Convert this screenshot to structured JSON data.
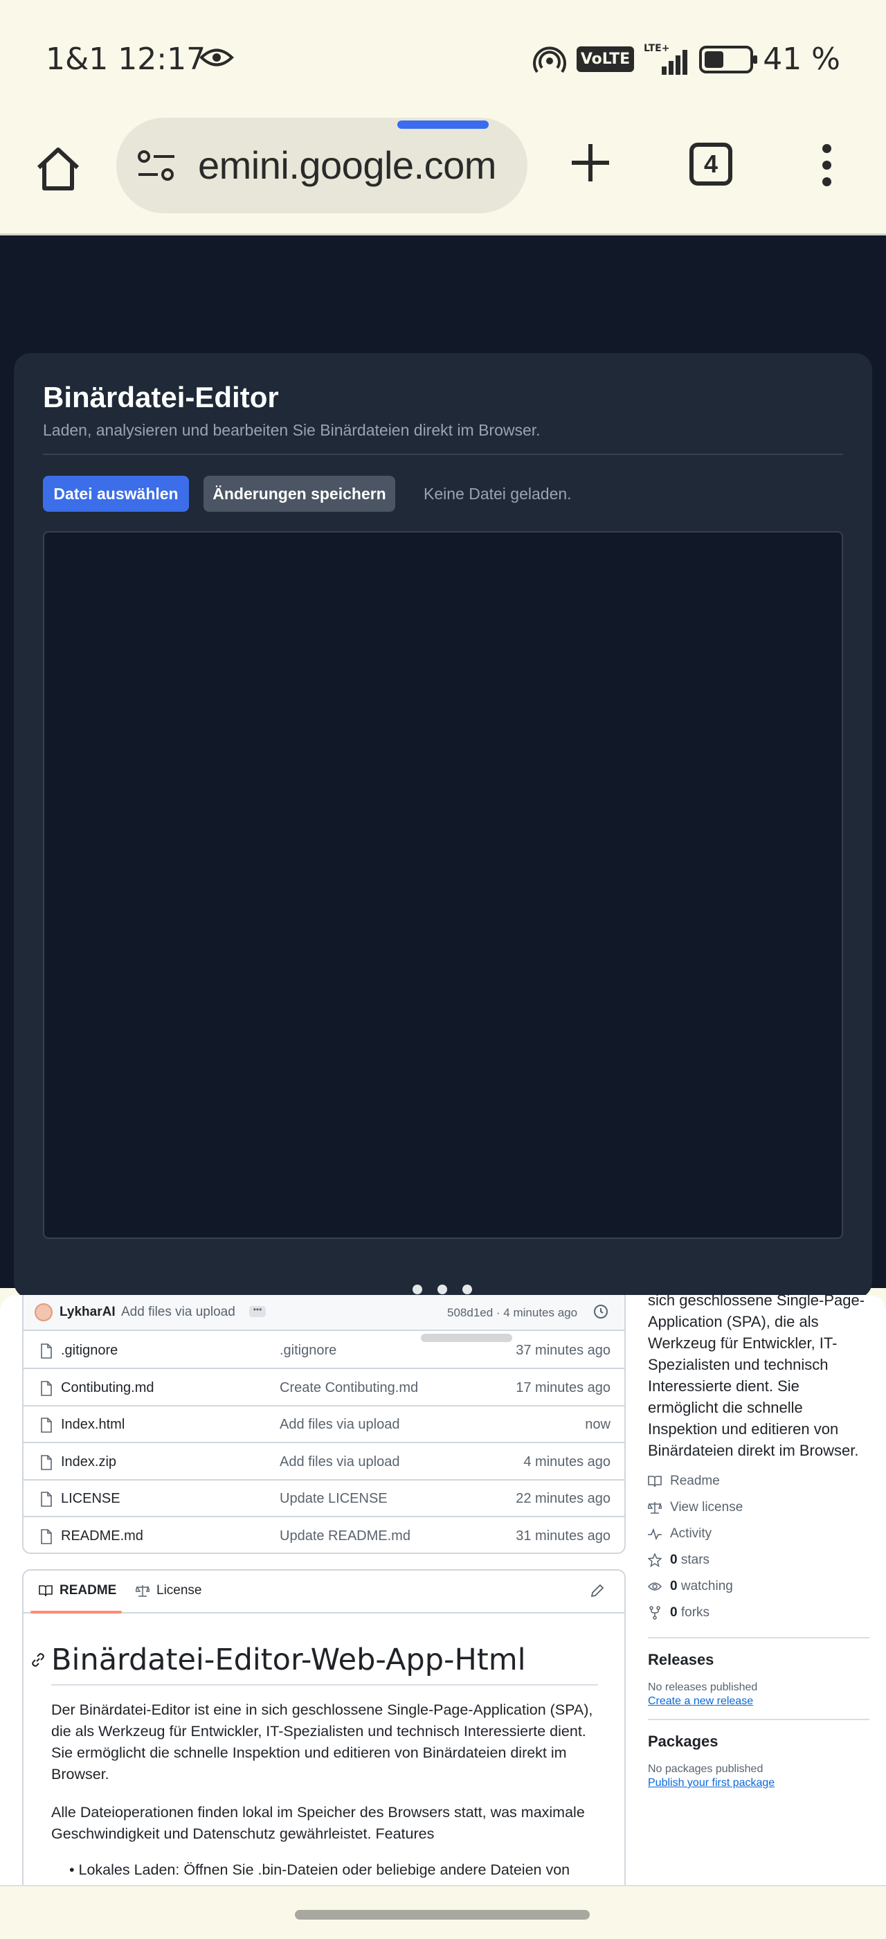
{
  "status_bar": {
    "carrier_time": "1&1 12:17",
    "network": "VoLTE",
    "lte": "LTE+",
    "battery_percent": "41 %",
    "battery_level": 0.41
  },
  "browser": {
    "url": "emini.google.com",
    "tab_count": "4",
    "load_progress": 0.3
  },
  "app": {
    "title": "Binärdatei-Editor",
    "subtitle": "Laden, analysieren und bearbeiten Sie Binärdateien direkt im Browser.",
    "select_file_label": "Datei auswählen",
    "save_changes_label": "Änderungen speichern",
    "status_text": "Keine Datei geladen."
  },
  "repo": {
    "commit": {
      "author": "LykharAI",
      "message": "Add files via upload",
      "dots": "•••",
      "meta": "508d1ed · 4 minutes ago"
    },
    "files": [
      {
        "name": ".gitignore",
        "message": ".gitignore",
        "time": "37 minutes ago"
      },
      {
        "name": "Contibuting.md",
        "message": "Create Contibuting.md",
        "time": "17 minutes ago"
      },
      {
        "name": "Index.html",
        "message": "Add files via upload",
        "time": "now"
      },
      {
        "name": "Index.zip",
        "message": "Add files via upload",
        "time": "4 minutes ago"
      },
      {
        "name": "LICENSE",
        "message": "Update LICENSE",
        "time": "22 minutes ago"
      },
      {
        "name": "README.md",
        "message": "Update README.md",
        "time": "31 minutes ago"
      }
    ],
    "readme_tabs": {
      "readme": "README",
      "license": "License"
    },
    "readme": {
      "title": "Binärdatei-Editor-Web-App-Html",
      "para1": "Der Binärdatei-Editor ist eine in sich geschlossene Single-Page-Application (SPA), die als Werkzeug für Entwickler, IT-Spezialisten und technisch Interessierte dient. Sie ermöglicht die schnelle Inspektion und editieren von Binärdateien direkt im Browser.",
      "para2": "Alle Dateioperationen finden lokal im Speicher des Browsers statt, was maximale Geschwindigkeit und Datenschutz gewährleistet. Features",
      "bullet1": "Lokales Laden: Öffnen Sie .bin-Dateien oder beliebige andere Dateien von"
    },
    "about": {
      "text": "sich geschlossene Single-Page-Application (SPA), die als Werkzeug für Entwickler, IT-Spezialisten und technisch Interessierte dient. Sie ermöglicht die schnelle Inspektion und editieren von Binärdateien direkt im Browser.",
      "readme": "Readme",
      "license": "View license",
      "activity": "Activity",
      "stars_count": "0",
      "stars_label": "stars",
      "watching_count": "0",
      "watching_label": "watching",
      "forks_count": "0",
      "forks_label": "forks"
    },
    "releases": {
      "heading": "Releases",
      "none": "No releases published",
      "create": "Create a new release"
    },
    "packages": {
      "heading": "Packages",
      "none": "No packages published",
      "publish": "Publish your first package"
    }
  }
}
